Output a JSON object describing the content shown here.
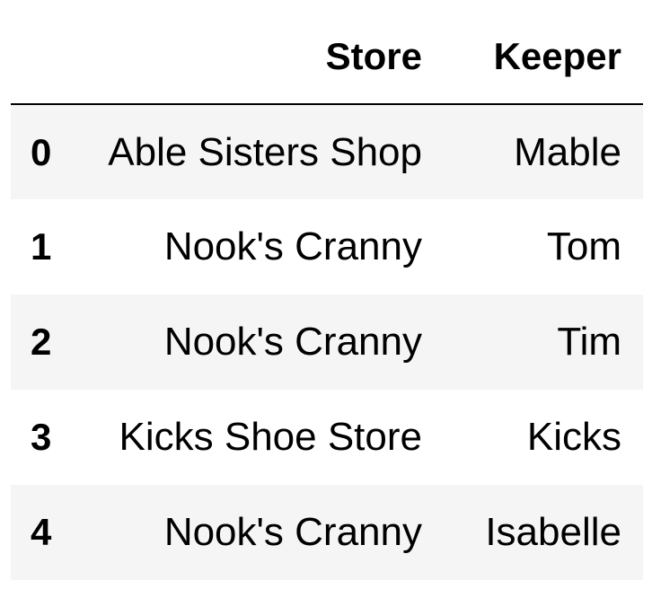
{
  "table": {
    "columns": [
      "Store",
      "Keeper"
    ],
    "rows": [
      {
        "index": "0",
        "store": "Able Sisters Shop",
        "keeper": "Mable"
      },
      {
        "index": "1",
        "store": "Nook's Cranny",
        "keeper": "Tom"
      },
      {
        "index": "2",
        "store": "Nook's Cranny",
        "keeper": "Tim"
      },
      {
        "index": "3",
        "store": "Kicks Shoe Store",
        "keeper": "Kicks"
      },
      {
        "index": "4",
        "store": "Nook's Cranny",
        "keeper": "Isabelle"
      }
    ]
  }
}
